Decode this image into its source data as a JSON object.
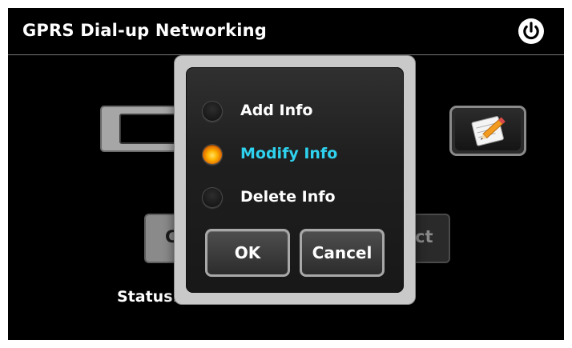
{
  "header": {
    "title": "GPRS Dial-up Networking",
    "power_icon": "power-icon"
  },
  "background": {
    "left_button_partial": "C",
    "right_button_partial": "ct",
    "status_label": "Status:",
    "edit_icon": "notepad-pencil-icon"
  },
  "dialog": {
    "options": [
      {
        "label": "Add Info",
        "selected": false
      },
      {
        "label": "Modify Info",
        "selected": true
      },
      {
        "label": "Delete Info",
        "selected": false
      }
    ],
    "ok_label": "OK",
    "cancel_label": "Cancel"
  },
  "colors": {
    "selected_text": "#2fd2ee",
    "radio_selected": "#ffb300"
  }
}
